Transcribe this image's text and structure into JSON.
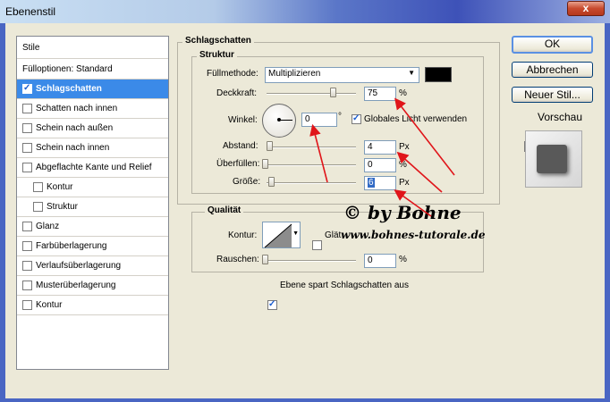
{
  "window": {
    "title": "Ebenenstil",
    "close_label": "x"
  },
  "left_panel": {
    "header": "Stile",
    "items": [
      {
        "label": "Fülloptionen: Standard",
        "checkbox": false,
        "checked": false,
        "indent": false,
        "selected": false
      },
      {
        "label": "Schlagschatten",
        "checkbox": true,
        "checked": true,
        "indent": false,
        "selected": true
      },
      {
        "label": "Schatten nach innen",
        "checkbox": true,
        "checked": false,
        "indent": false,
        "selected": false
      },
      {
        "label": "Schein nach außen",
        "checkbox": true,
        "checked": false,
        "indent": false,
        "selected": false
      },
      {
        "label": "Schein nach innen",
        "checkbox": true,
        "checked": false,
        "indent": false,
        "selected": false
      },
      {
        "label": "Abgeflachte Kante und Relief",
        "checkbox": true,
        "checked": false,
        "indent": false,
        "selected": false
      },
      {
        "label": "Kontur",
        "checkbox": true,
        "checked": false,
        "indent": true,
        "selected": false
      },
      {
        "label": "Struktur",
        "checkbox": true,
        "checked": false,
        "indent": true,
        "selected": false
      },
      {
        "label": "Glanz",
        "checkbox": true,
        "checked": false,
        "indent": false,
        "selected": false
      },
      {
        "label": "Farbüberlagerung",
        "checkbox": true,
        "checked": false,
        "indent": false,
        "selected": false
      },
      {
        "label": "Verlaufsüberlagerung",
        "checkbox": true,
        "checked": false,
        "indent": false,
        "selected": false
      },
      {
        "label": "Musterüberlagerung",
        "checkbox": true,
        "checked": false,
        "indent": false,
        "selected": false
      },
      {
        "label": "Kontur",
        "checkbox": true,
        "checked": false,
        "indent": false,
        "selected": false
      }
    ]
  },
  "main": {
    "section_title": "Schlagschatten",
    "struktur": {
      "title": "Struktur",
      "fuellmethode_label": "Füllmethode:",
      "fuellmethode_value": "Multiplizieren",
      "color_swatch": "#000000",
      "deckkraft_label": "Deckkraft:",
      "deckkraft_value": "75",
      "deckkraft_unit": "%",
      "deckkraft_level": 0.75,
      "winkel_label": "Winkel:",
      "winkel_value": "0",
      "winkel_unit": "°",
      "global_light_label": "Globales Licht verwenden",
      "global_light_checked": true,
      "abstand_label": "Abstand:",
      "abstand_value": "4",
      "abstand_unit": "Px",
      "ueberfuellen_label": "Überfüllen:",
      "ueberfuellen_value": "0",
      "ueberfuellen_unit": "%",
      "groesse_label": "Größe:",
      "groesse_value": "6",
      "groesse_unit": "Px"
    },
    "qualitaet": {
      "title": "Qualität",
      "kontur_label": "Kontur:",
      "glaetten_label": "Glät",
      "rauschen_label": "Rauschen:",
      "rauschen_value": "0",
      "rauschen_unit": "%"
    },
    "ebene_spart_label": "Ebene spart Schlagschatten aus",
    "ebene_spart_checked": true
  },
  "buttons": {
    "ok": "OK",
    "abbrechen": "Abbrechen",
    "neuer_stil": "Neuer Stil...",
    "vorschau_label": "Vorschau",
    "vorschau_checked": true
  },
  "watermark": {
    "line1": "© by Bohne",
    "line2": "www.bohnes-tutorale.de"
  },
  "colors": {
    "selection": "#3b8ae8",
    "arrow": "#e0151a",
    "default_button_border": "#5a90e3"
  },
  "icons": [
    "close-icon",
    "checkbox-icon",
    "dropdown-arrow-icon",
    "angle-dial-icon",
    "slider-thumb-icon",
    "contour-preview-icon",
    "red-arrow-icon"
  ]
}
